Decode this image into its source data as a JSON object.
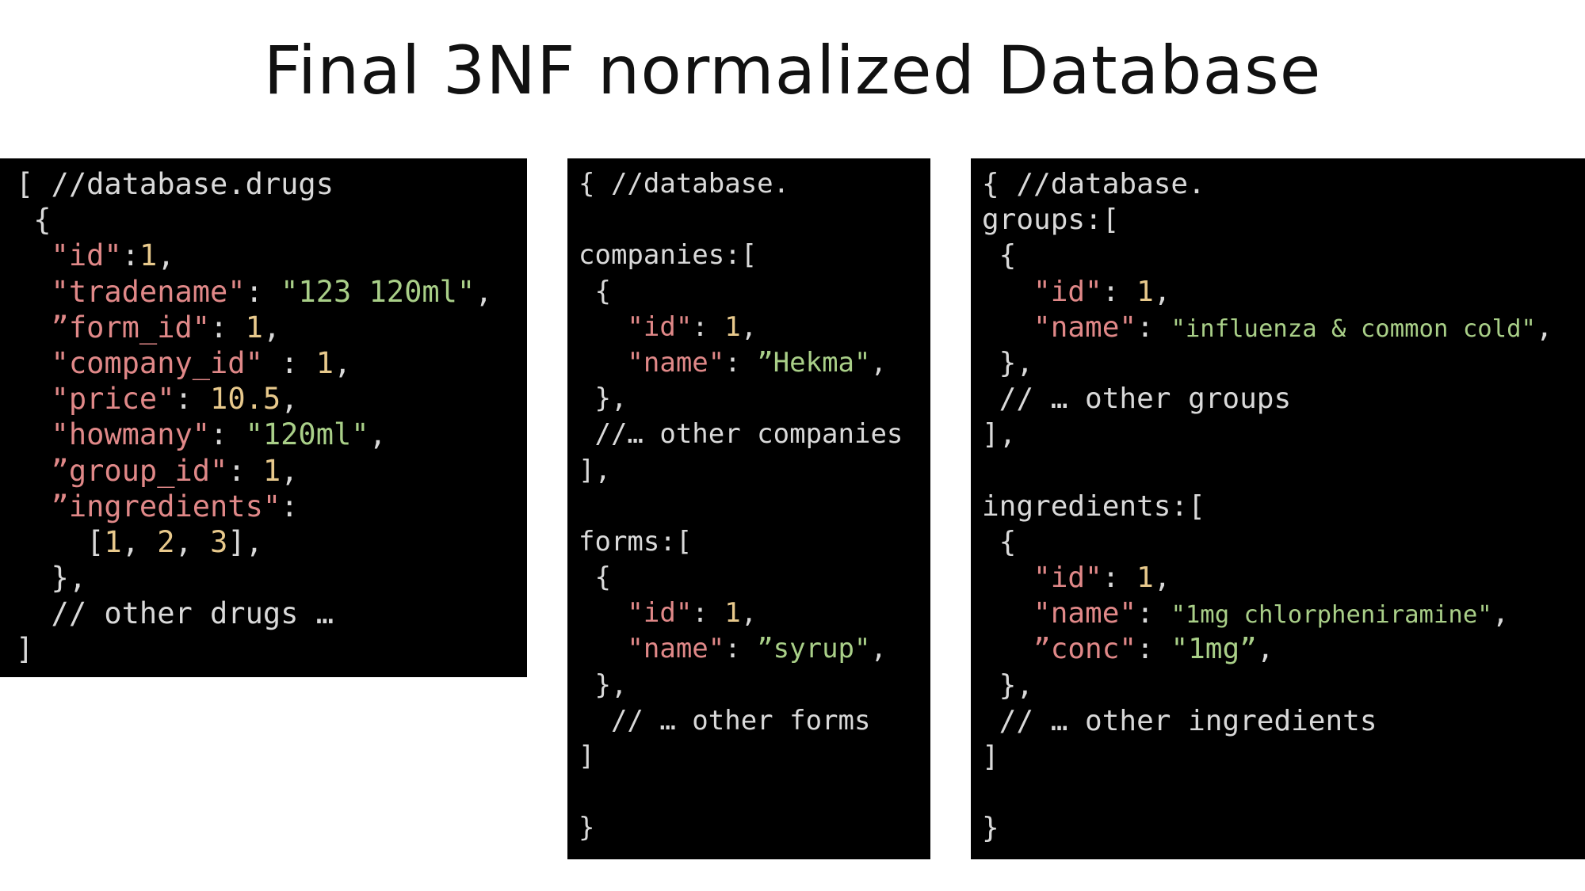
{
  "title": "Final 3NF normalized Database",
  "panels": [
    {
      "name": "drugs",
      "lines": [
        [
          [
            "p",
            "[ //database.drugs"
          ]
        ],
        [
          [
            "p",
            " {"
          ]
        ],
        [
          [
            "k",
            "  \"id\""
          ],
          [
            "p",
            ":"
          ],
          [
            "n",
            "1"
          ],
          [
            "p",
            ","
          ]
        ],
        [
          [
            "k",
            "  \"tradename\""
          ],
          [
            "p",
            ": "
          ],
          [
            "s",
            "\"123 120ml\""
          ],
          [
            "p",
            ","
          ]
        ],
        [
          [
            "k",
            "  ”form_id\""
          ],
          [
            "p",
            ": "
          ],
          [
            "n",
            "1"
          ],
          [
            "p",
            ","
          ]
        ],
        [
          [
            "k",
            "  \"company_id\""
          ],
          [
            "p",
            " : "
          ],
          [
            "n",
            "1"
          ],
          [
            "p",
            ","
          ]
        ],
        [
          [
            "k",
            "  \"price\""
          ],
          [
            "p",
            ": "
          ],
          [
            "n",
            "10.5"
          ],
          [
            "p",
            ","
          ]
        ],
        [
          [
            "k",
            "  \"howmany\""
          ],
          [
            "p",
            ": "
          ],
          [
            "s",
            "\"120ml\""
          ],
          [
            "p",
            ","
          ]
        ],
        [
          [
            "k",
            "  ”group_id\""
          ],
          [
            "p",
            ": "
          ],
          [
            "n",
            "1"
          ],
          [
            "p",
            ","
          ]
        ],
        [
          [
            "k",
            "  ”ingredients\""
          ],
          [
            "p",
            ":"
          ]
        ],
        [
          [
            "p",
            "    ["
          ],
          [
            "n",
            "1"
          ],
          [
            "p",
            ", "
          ],
          [
            "n",
            "2"
          ],
          [
            "p",
            ", "
          ],
          [
            "n",
            "3"
          ],
          [
            "p",
            "],"
          ]
        ],
        [
          [
            "p",
            "  },"
          ]
        ],
        [
          [
            "p",
            "  // other drugs …"
          ]
        ],
        [
          [
            "p",
            "]"
          ]
        ]
      ]
    },
    {
      "name": "companies-forms",
      "lines": [
        [
          [
            "p",
            "{ //database."
          ]
        ],
        [
          [
            "p",
            ""
          ]
        ],
        [
          [
            "p",
            "companies:["
          ]
        ],
        [
          [
            "p",
            " {"
          ]
        ],
        [
          [
            "k",
            "   \"id\""
          ],
          [
            "p",
            ": "
          ],
          [
            "n",
            "1"
          ],
          [
            "p",
            ","
          ]
        ],
        [
          [
            "k",
            "   \"name\""
          ],
          [
            "p",
            ": "
          ],
          [
            "s",
            "”Hekma\""
          ],
          [
            "p",
            ","
          ]
        ],
        [
          [
            "p",
            " },"
          ]
        ],
        [
          [
            "p",
            " //… other companies"
          ]
        ],
        [
          [
            "p",
            "],"
          ]
        ],
        [
          [
            "p",
            ""
          ]
        ],
        [
          [
            "p",
            "forms:["
          ]
        ],
        [
          [
            "p",
            " {"
          ]
        ],
        [
          [
            "k",
            "   \"id\""
          ],
          [
            "p",
            ": "
          ],
          [
            "n",
            "1"
          ],
          [
            "p",
            ","
          ]
        ],
        [
          [
            "k",
            "   \"name\""
          ],
          [
            "p",
            ": "
          ],
          [
            "s",
            "”syrup\""
          ],
          [
            "p",
            ","
          ]
        ],
        [
          [
            "p",
            " },"
          ]
        ],
        [
          [
            "p",
            "  // … other forms"
          ]
        ],
        [
          [
            "p",
            "]"
          ]
        ],
        [
          [
            "p",
            ""
          ]
        ],
        [
          [
            "p",
            "}"
          ]
        ]
      ]
    },
    {
      "name": "groups-ingredients",
      "lines": [
        [
          [
            "p",
            "{ //database."
          ]
        ],
        [
          [
            "p",
            "groups:["
          ]
        ],
        [
          [
            "p",
            " {"
          ]
        ],
        [
          [
            "k",
            "   \"id\""
          ],
          [
            "p",
            ": "
          ],
          [
            "n",
            "1"
          ],
          [
            "p",
            ","
          ]
        ],
        [
          [
            "k",
            "   \"name\""
          ],
          [
            "p",
            ": "
          ],
          [
            "s",
            "\"influenza & common cold\""
          ],
          [
            "p",
            ","
          ]
        ],
        [
          [
            "p",
            " },"
          ]
        ],
        [
          [
            "p",
            " // … other groups"
          ]
        ],
        [
          [
            "p",
            "],"
          ]
        ],
        [
          [
            "p",
            ""
          ]
        ],
        [
          [
            "p",
            "ingredients:["
          ]
        ],
        [
          [
            "p",
            " {"
          ]
        ],
        [
          [
            "k",
            "   \"id\""
          ],
          [
            "p",
            ": "
          ],
          [
            "n",
            "1"
          ],
          [
            "p",
            ","
          ]
        ],
        [
          [
            "k",
            "   \"name\""
          ],
          [
            "p",
            ": "
          ],
          [
            "s",
            "\"1mg chlorpheniramine\""
          ],
          [
            "p",
            ","
          ]
        ],
        [
          [
            "k",
            "   ”conc\""
          ],
          [
            "p",
            ": "
          ],
          [
            "s",
            "\"1mg”"
          ],
          [
            "p",
            ","
          ]
        ],
        [
          [
            "p",
            " },"
          ]
        ],
        [
          [
            "p",
            " // … other ingredients"
          ]
        ],
        [
          [
            "p",
            "]"
          ]
        ],
        [
          [
            "p",
            ""
          ]
        ],
        [
          [
            "p",
            "}"
          ]
        ]
      ]
    }
  ]
}
